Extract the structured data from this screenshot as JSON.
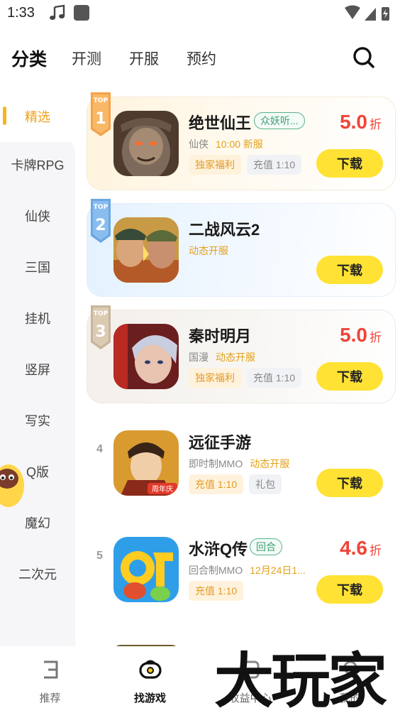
{
  "status_bar": {
    "time": "1:33"
  },
  "top_nav": {
    "tabs": [
      {
        "label": "分类",
        "active": true
      },
      {
        "label": "开测",
        "active": false
      },
      {
        "label": "开服",
        "active": false
      },
      {
        "label": "预约",
        "active": false
      }
    ],
    "search_icon": "search-icon"
  },
  "sidebar": {
    "items": [
      {
        "label": "精选",
        "active": true
      },
      {
        "label": "卡牌RPG"
      },
      {
        "label": "仙侠"
      },
      {
        "label": "三国"
      },
      {
        "label": "挂机"
      },
      {
        "label": "竖屏"
      },
      {
        "label": "写实"
      },
      {
        "label": "Q版"
      },
      {
        "label": "魔幻"
      },
      {
        "label": "二次元"
      }
    ]
  },
  "games": [
    {
      "rank": "1",
      "name": "绝世仙王",
      "name_tag": "众妖听...",
      "category": "仙侠",
      "event": "10:00 新服",
      "tags": [
        {
          "text": "独家福利",
          "style": "orange"
        },
        {
          "text": "充值 1:10",
          "style": "gray"
        }
      ],
      "discount": "5.0",
      "discount_unit": "折",
      "download": "下载"
    },
    {
      "rank": "2",
      "name": "二战风云2",
      "name_tag": "",
      "category": "",
      "event": "动态开服",
      "tags": [],
      "discount": "",
      "discount_unit": "",
      "download": "下载"
    },
    {
      "rank": "3",
      "name": "秦时明月",
      "name_tag": "",
      "category": "国漫",
      "event": "动态开服",
      "tags": [
        {
          "text": "独家福利",
          "style": "orange"
        },
        {
          "text": "充值 1:10",
          "style": "gray"
        }
      ],
      "discount": "5.0",
      "discount_unit": "折",
      "download": "下载"
    },
    {
      "rank": "4",
      "name": "远征手游",
      "name_tag": "",
      "category": "即时制MMO",
      "event": "动态开服",
      "tags": [
        {
          "text": "充值 1:10",
          "style": "orange"
        },
        {
          "text": "礼包",
          "style": "gray"
        }
      ],
      "discount": "",
      "discount_unit": "",
      "download": "下载"
    },
    {
      "rank": "5",
      "name": "水浒Q传",
      "name_tag": "回合",
      "category": "回合制MMO",
      "event": "12月24日1...",
      "tags": [
        {
          "text": "充值 1:10",
          "style": "orange"
        }
      ],
      "discount": "4.6",
      "discount_unit": "折",
      "download": "下载"
    }
  ],
  "bottom_nav": [
    {
      "label": "推荐",
      "icon": "recommend-icon",
      "active": false
    },
    {
      "label": "找游戏",
      "icon": "find-game-icon",
      "active": true
    },
    {
      "label": "收益中心",
      "icon": "earnings-icon",
      "active": false
    },
    {
      "label": "我的",
      "icon": "profile-icon",
      "active": false
    }
  ],
  "watermark": {
    "text": "大玩家"
  },
  "colors": {
    "accent": "#f5b71f",
    "download_button": "#ffe234",
    "discount": "#f04438",
    "event": "#e3a11a"
  }
}
